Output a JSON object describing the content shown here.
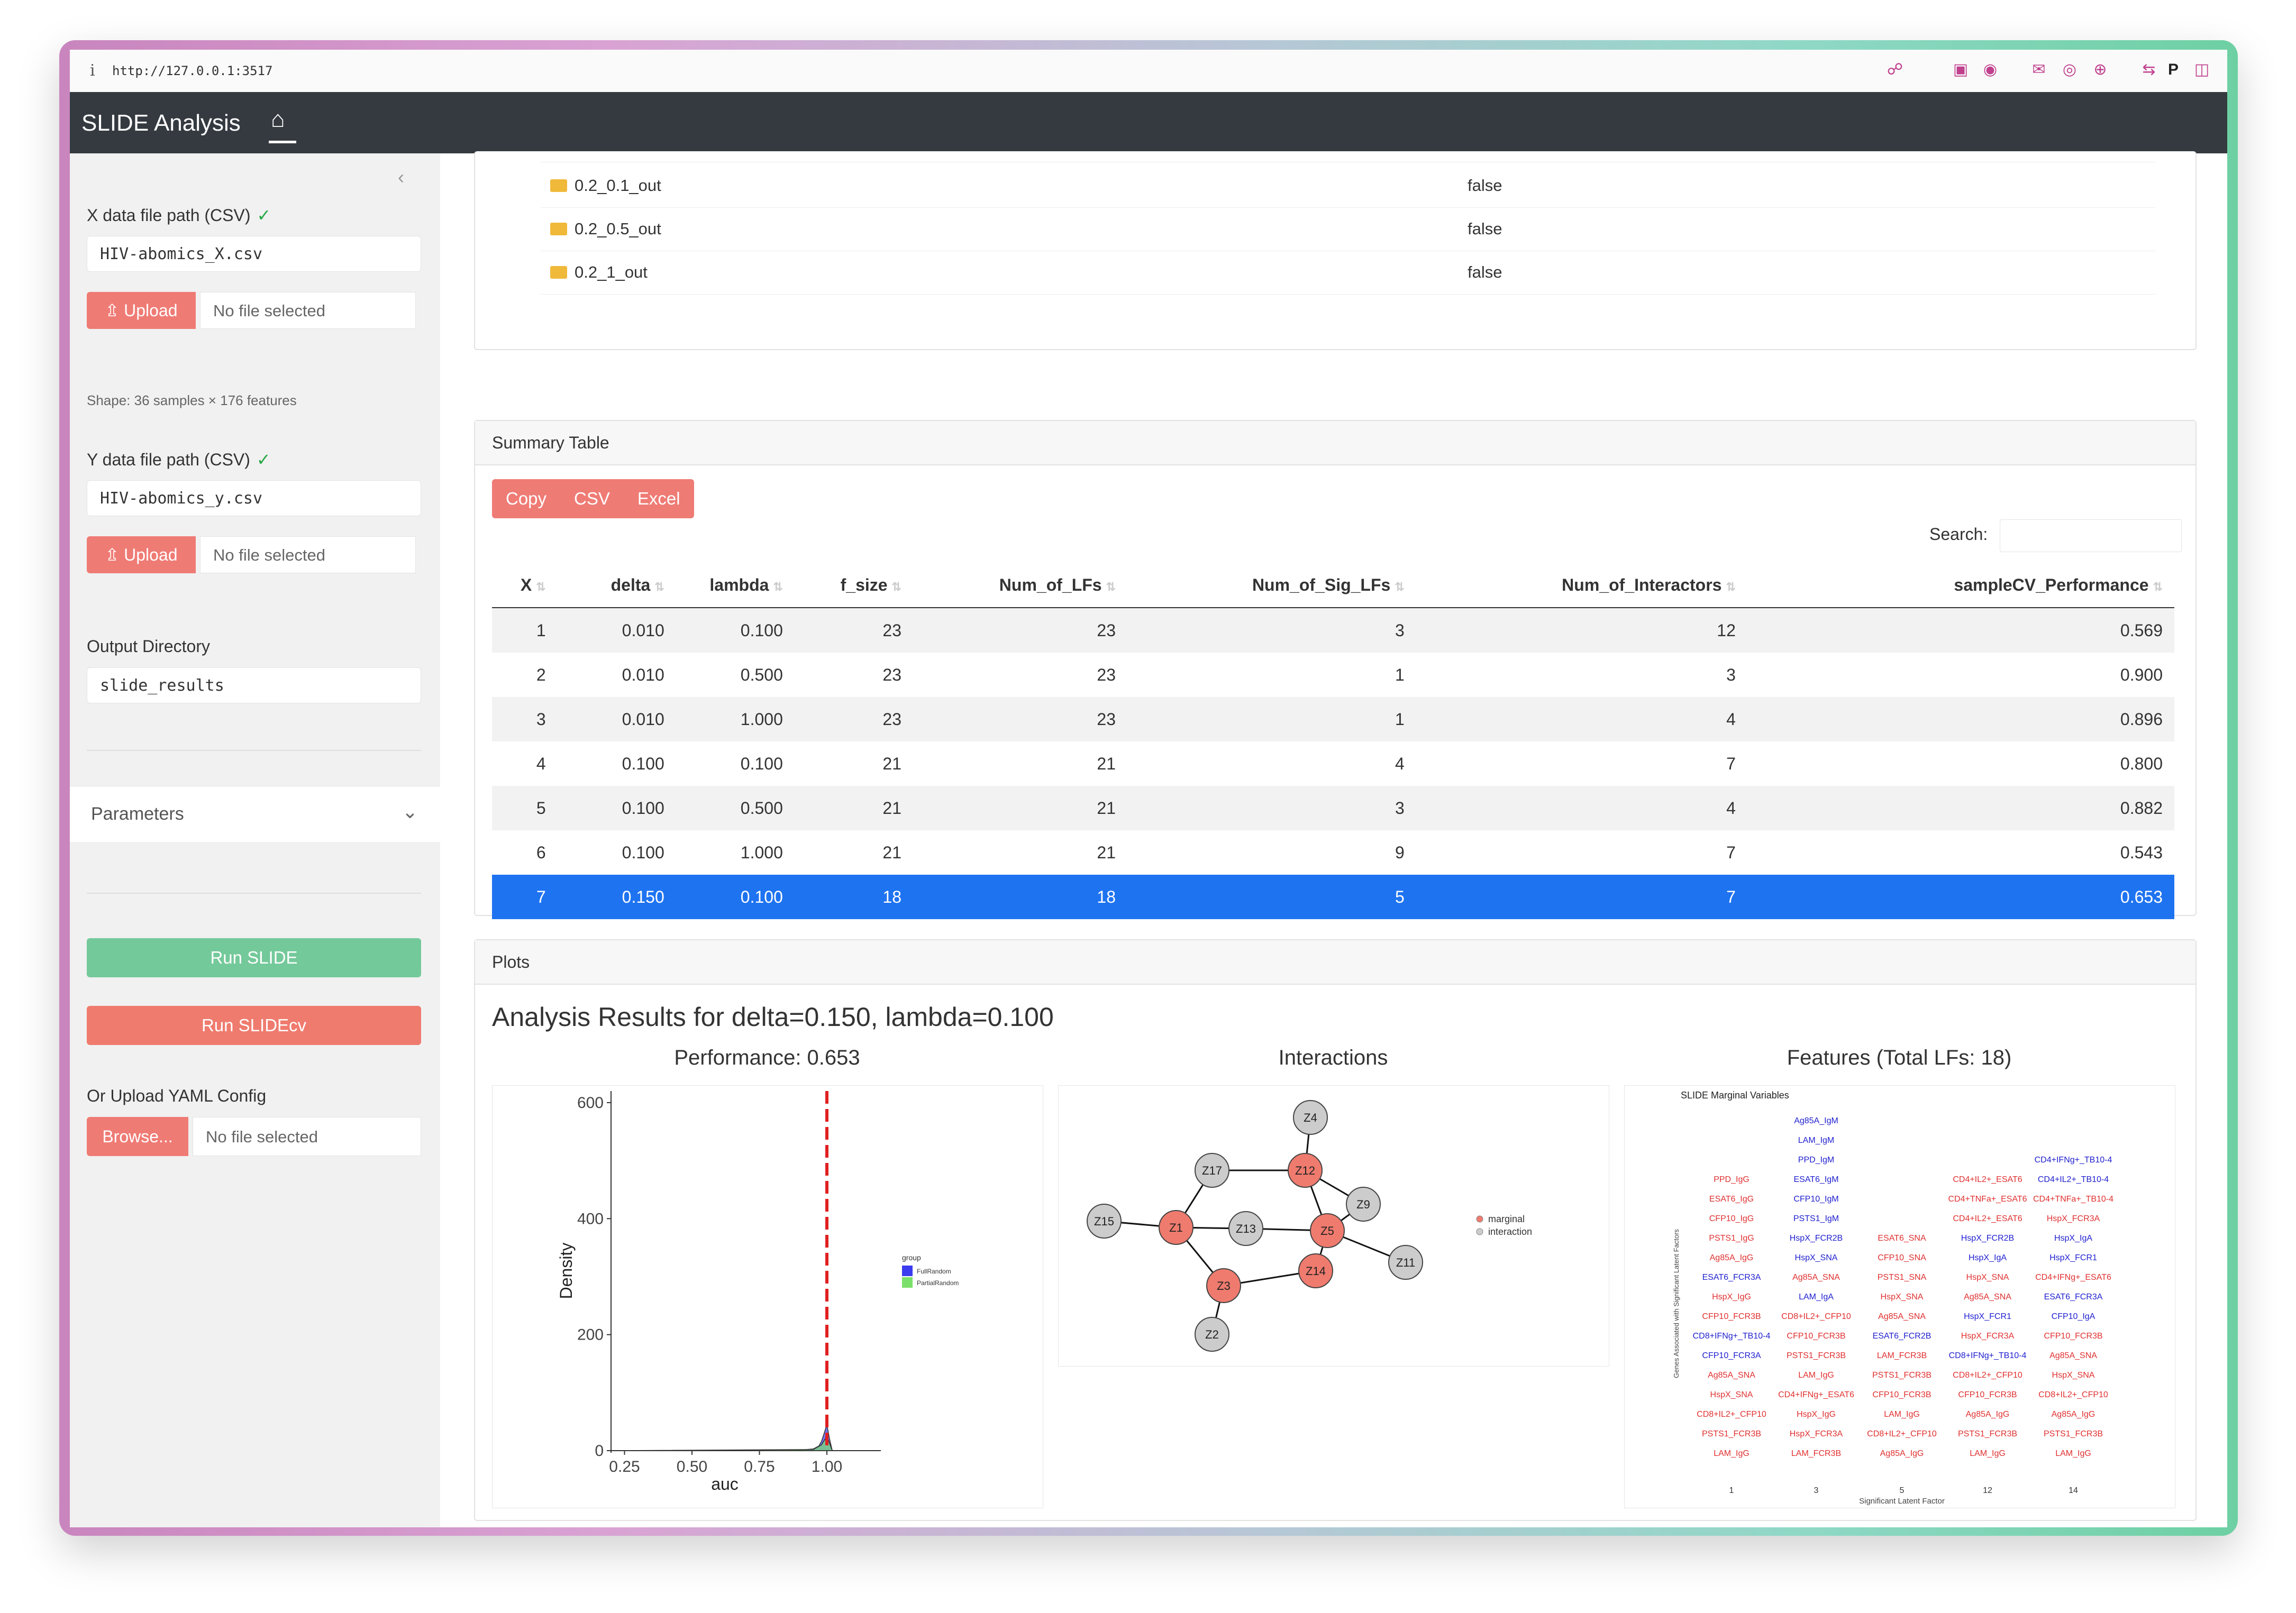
{
  "browser": {
    "info_glyph": "i",
    "url": "http://127.0.0.1:3517"
  },
  "navbar": {
    "title": "SLIDE Analysis"
  },
  "sidebar": {
    "x_label": "X data file path (CSV)",
    "x_value": "HIV-abomics_X.csv",
    "upload_label": "Upload",
    "no_file": "No file selected",
    "shape_text": "Shape: 36 samples × 176 features",
    "y_label": "Y data file path (CSV)",
    "y_value": "HIV-abomics_y.csv",
    "output_label": "Output Directory",
    "output_value": "slide_results",
    "params_label": "Parameters",
    "run_slide": "Run SLIDE",
    "run_slidecv": "Run SLIDEcv",
    "yaml_label": "Or Upload YAML Config",
    "browse_label": "Browse...",
    "check": "✓"
  },
  "files": {
    "rows": [
      {
        "name": "0.2_0.1_out",
        "value": "false"
      },
      {
        "name": "0.2_0.5_out",
        "value": "false"
      },
      {
        "name": "0.2_1_out",
        "value": "false"
      }
    ]
  },
  "summary": {
    "header": "Summary Table",
    "buttons": [
      "Copy",
      "CSV",
      "Excel"
    ],
    "search_label": "Search:",
    "columns": [
      "X",
      "delta",
      "lambda",
      "f_size",
      "Num_of_LFs",
      "Num_of_Sig_LFs",
      "Num_of_Interactors",
      "sampleCV_Performance"
    ],
    "rows": [
      [
        "1",
        "0.010",
        "0.100",
        "23",
        "23",
        "3",
        "12",
        "0.569"
      ],
      [
        "2",
        "0.010",
        "0.500",
        "23",
        "23",
        "1",
        "3",
        "0.900"
      ],
      [
        "3",
        "0.010",
        "1.000",
        "23",
        "23",
        "1",
        "4",
        "0.896"
      ],
      [
        "4",
        "0.100",
        "0.100",
        "21",
        "21",
        "4",
        "7",
        "0.800"
      ],
      [
        "5",
        "0.100",
        "0.500",
        "21",
        "21",
        "3",
        "4",
        "0.882"
      ],
      [
        "6",
        "0.100",
        "1.000",
        "21",
        "21",
        "9",
        "7",
        "0.543"
      ],
      [
        "7",
        "0.150",
        "0.100",
        "18",
        "18",
        "5",
        "7",
        "0.653"
      ]
    ],
    "selected_row": 6
  },
  "plots": {
    "header": "Plots",
    "title": "Analysis Results for delta=0.150, lambda=0.100",
    "performance_title": "Performance: 0.653",
    "interactions_title": "Interactions",
    "features_title": "Features (Total LFs: 18)"
  },
  "chart_data": [
    {
      "type": "area",
      "title": "Performance: 0.653",
      "xlabel": "auc",
      "ylabel": "Density",
      "x_ticks": [
        "0.25",
        "0.50",
        "0.75",
        "1.00"
      ],
      "y_ticks": [
        "0",
        "200",
        "400",
        "600"
      ],
      "xlim": [
        0.2,
        1.2
      ],
      "ylim": [
        0,
        620
      ],
      "legend_title": "group",
      "legend_placement": "right",
      "series": [
        {
          "name": "FullRandom",
          "color": "#3b3bf0",
          "x": [
            0.2,
            0.9,
            0.95,
            0.97,
            0.98,
            0.99,
            1.0,
            1.01,
            1.02
          ],
          "y": [
            0,
            1,
            3,
            8,
            16,
            30,
            45,
            20,
            0
          ]
        },
        {
          "name": "PartialRandom",
          "color": "#7be06b",
          "x": [
            0.2,
            0.95,
            0.98,
            1.0,
            1.02
          ],
          "y": [
            0,
            2,
            10,
            25,
            0
          ]
        }
      ],
      "vline": {
        "x": 1.0,
        "color": "#e02020"
      }
    }
  ],
  "network": {
    "legend": [
      {
        "label": "marginal",
        "color": "#ef7b6e"
      },
      {
        "label": "interaction",
        "color": "#cccccc"
      }
    ],
    "nodes": [
      {
        "id": "Z4",
        "type": "interaction"
      },
      {
        "id": "Z17",
        "type": "interaction"
      },
      {
        "id": "Z12",
        "type": "marginal"
      },
      {
        "id": "Z9",
        "type": "interaction"
      },
      {
        "id": "Z15",
        "type": "interaction"
      },
      {
        "id": "Z1",
        "type": "marginal"
      },
      {
        "id": "Z13",
        "type": "interaction"
      },
      {
        "id": "Z5",
        "type": "marginal"
      },
      {
        "id": "Z14",
        "type": "marginal"
      },
      {
        "id": "Z11",
        "type": "interaction"
      },
      {
        "id": "Z3",
        "type": "marginal"
      },
      {
        "id": "Z2",
        "type": "interaction"
      }
    ],
    "edges": [
      [
        "Z4",
        "Z12"
      ],
      [
        "Z17",
        "Z12"
      ],
      [
        "Z17",
        "Z1"
      ],
      [
        "Z12",
        "Z9"
      ],
      [
        "Z12",
        "Z5"
      ],
      [
        "Z15",
        "Z1"
      ],
      [
        "Z1",
        "Z13"
      ],
      [
        "Z1",
        "Z3"
      ],
      [
        "Z13",
        "Z5"
      ],
      [
        "Z5",
        "Z9"
      ],
      [
        "Z5",
        "Z14"
      ],
      [
        "Z5",
        "Z11"
      ],
      [
        "Z14",
        "Z3"
      ],
      [
        "Z3",
        "Z2"
      ]
    ]
  },
  "features": {
    "panel_title": "SLIDE Marginal Variables",
    "ylabel": "Genes Associated with Significant Latent Factors",
    "xlabel": "Significant Latent Factor",
    "colors": {
      "up": "#e03030",
      "down": "#2020d0"
    },
    "columns": [
      {
        "label": "1",
        "items": [
          {
            "t": "PPD_IgG",
            "c": "up"
          },
          {
            "t": "ESAT6_IgG",
            "c": "up"
          },
          {
            "t": "CFP10_IgG",
            "c": "up"
          },
          {
            "t": "PSTS1_IgG",
            "c": "up"
          },
          {
            "t": "Ag85A_IgG",
            "c": "up"
          },
          {
            "t": "ESAT6_FCR3A",
            "c": "down"
          },
          {
            "t": "HspX_IgG",
            "c": "up"
          },
          {
            "t": "CFP10_FCR3B",
            "c": "up"
          },
          {
            "t": "CD8+IFNg+_TB10-4",
            "c": "down"
          },
          {
            "t": "CFP10_FCR3A",
            "c": "down"
          },
          {
            "t": "Ag85A_SNA",
            "c": "up"
          },
          {
            "t": "HspX_SNA",
            "c": "up"
          },
          {
            "t": "CD8+IL2+_CFP10",
            "c": "up"
          },
          {
            "t": "PSTS1_FCR3B",
            "c": "up"
          },
          {
            "t": "LAM_IgG",
            "c": "up"
          }
        ]
      },
      {
        "label": "3",
        "items": [
          {
            "t": "Ag85A_IgM",
            "c": "down"
          },
          {
            "t": "LAM_IgM",
            "c": "down"
          },
          {
            "t": "PPD_IgM",
            "c": "down"
          },
          {
            "t": "ESAT6_IgM",
            "c": "down"
          },
          {
            "t": "CFP10_IgM",
            "c": "down"
          },
          {
            "t": "PSTS1_IgM",
            "c": "down"
          },
          {
            "t": "HspX_FCR2B",
            "c": "down"
          },
          {
            "t": "HspX_SNA",
            "c": "down"
          },
          {
            "t": "Ag85A_SNA",
            "c": "up"
          },
          {
            "t": "LAM_IgA",
            "c": "down"
          },
          {
            "t": "CD8+IL2+_CFP10",
            "c": "up"
          },
          {
            "t": "CFP10_FCR3B",
            "c": "up"
          },
          {
            "t": "PSTS1_FCR3B",
            "c": "up"
          },
          {
            "t": "LAM_IgG",
            "c": "up"
          },
          {
            "t": "CD4+IFNg+_ESAT6",
            "c": "up"
          },
          {
            "t": "HspX_IgG",
            "c": "up"
          },
          {
            "t": "HspX_FCR3A",
            "c": "up"
          },
          {
            "t": "LAM_FCR3B",
            "c": "up"
          }
        ]
      },
      {
        "label": "5",
        "items": [
          {
            "t": "ESAT6_SNA",
            "c": "up"
          },
          {
            "t": "CFP10_SNA",
            "c": "up"
          },
          {
            "t": "PSTS1_SNA",
            "c": "up"
          },
          {
            "t": "HspX_SNA",
            "c": "up"
          },
          {
            "t": "Ag85A_SNA",
            "c": "up"
          },
          {
            "t": "ESAT6_FCR2B",
            "c": "down"
          },
          {
            "t": "LAM_FCR3B",
            "c": "up"
          },
          {
            "t": "PSTS1_FCR3B",
            "c": "up"
          },
          {
            "t": "CFP10_FCR3B",
            "c": "up"
          },
          {
            "t": "LAM_IgG",
            "c": "up"
          },
          {
            "t": "CD8+IL2+_CFP10",
            "c": "up"
          },
          {
            "t": "Ag85A_IgG",
            "c": "up"
          }
        ]
      },
      {
        "label": "12",
        "items": [
          {
            "t": "CD4+IL2+_ESAT6",
            "c": "up"
          },
          {
            "t": "CD4+TNFa+_ESAT6",
            "c": "up"
          },
          {
            "t": "CD4+IL2+_ESAT6",
            "c": "up"
          },
          {
            "t": "HspX_FCR2B",
            "c": "down"
          },
          {
            "t": "HspX_IgA",
            "c": "down"
          },
          {
            "t": "HspX_SNA",
            "c": "up"
          },
          {
            "t": "Ag85A_SNA",
            "c": "up"
          },
          {
            "t": "HspX_FCR1",
            "c": "down"
          },
          {
            "t": "HspX_FCR3A",
            "c": "up"
          },
          {
            "t": "CD8+IFNg+_TB10-4",
            "c": "down"
          },
          {
            "t": "CD8+IL2+_CFP10",
            "c": "up"
          },
          {
            "t": "CFP10_FCR3B",
            "c": "up"
          },
          {
            "t": "Ag85A_IgG",
            "c": "up"
          },
          {
            "t": "PSTS1_FCR3B",
            "c": "up"
          },
          {
            "t": "LAM_IgG",
            "c": "up"
          }
        ]
      },
      {
        "label": "14",
        "items": [
          {
            "t": "CD4+IFNg+_TB10-4",
            "c": "down"
          },
          {
            "t": "CD4+IL2+_TB10-4",
            "c": "down"
          },
          {
            "t": "CD4+TNFa+_TB10-4",
            "c": "up"
          },
          {
            "t": "HspX_FCR3A",
            "c": "up"
          },
          {
            "t": "HspX_IgA",
            "c": "down"
          },
          {
            "t": "HspX_FCR1",
            "c": "down"
          },
          {
            "t": "CD4+IFNg+_ESAT6",
            "c": "up"
          },
          {
            "t": "ESAT6_FCR3A",
            "c": "down"
          },
          {
            "t": "CFP10_IgA",
            "c": "down"
          },
          {
            "t": "CFP10_FCR3B",
            "c": "up"
          },
          {
            "t": "Ag85A_SNA",
            "c": "up"
          },
          {
            "t": "HspX_SNA",
            "c": "up"
          },
          {
            "t": "CD8+IL2+_CFP10",
            "c": "up"
          },
          {
            "t": "Ag85A_IgG",
            "c": "up"
          },
          {
            "t": "PSTS1_FCR3B",
            "c": "up"
          },
          {
            "t": "LAM_IgG",
            "c": "up"
          }
        ]
      }
    ]
  }
}
